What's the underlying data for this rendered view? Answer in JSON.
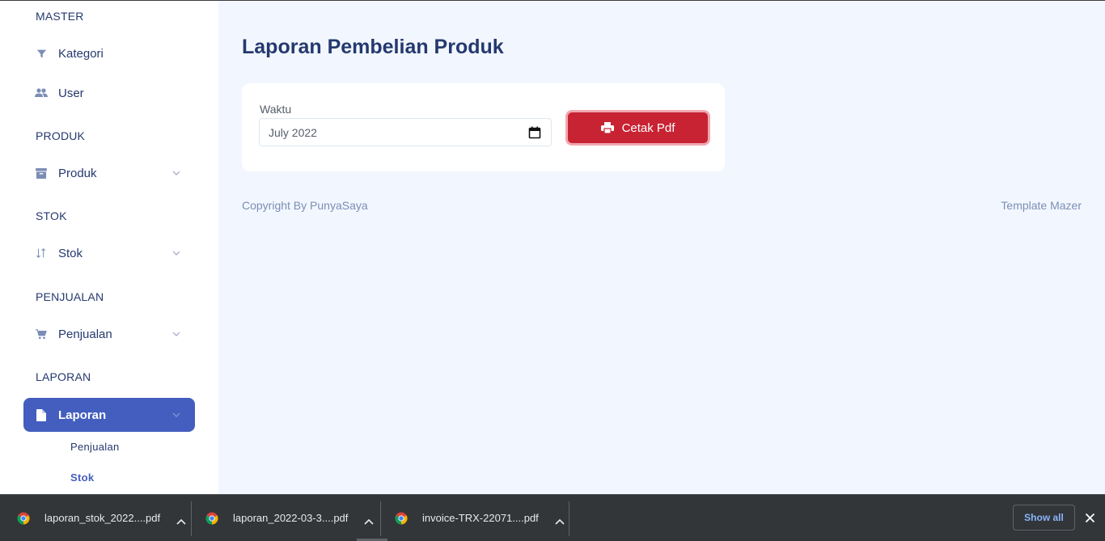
{
  "sidebar": {
    "sections": {
      "master": "MASTER",
      "produk": "PRODUK",
      "stok": "STOK",
      "penjualan": "PENJUALAN",
      "laporan": "LAPORAN"
    },
    "items": {
      "kategori": "Kategori",
      "user": "User",
      "produk": "Produk",
      "stok": "Stok",
      "penjualan": "Penjualan",
      "laporan": "Laporan"
    },
    "submenu": {
      "penjualan": "Penjualan",
      "stok": "Stok"
    }
  },
  "main": {
    "title": "Laporan Pembelian Produk",
    "form": {
      "label": "Waktu",
      "value": "July 2022",
      "button_label": "Cetak Pdf"
    }
  },
  "footer": {
    "left": "Copyright By PunyaSaya",
    "right": "Template Mazer"
  },
  "downloads": {
    "items": [
      "laporan_stok_2022....pdf",
      "laporan_2022-03-3....pdf",
      "invoice-TRX-22071....pdf"
    ],
    "show_all": "Show all"
  },
  "colors": {
    "accent": "#435ebe",
    "danger": "#c82333",
    "background": "#f2f7ff",
    "text": "#25396f"
  },
  "icons": [
    "filter-icon",
    "users-icon",
    "archive-icon",
    "sort-arrows-icon",
    "cart-icon",
    "file-icon",
    "chevron-down-icon",
    "calendar-icon",
    "printer-icon",
    "chrome-icon",
    "caret-up-icon",
    "close-icon"
  ]
}
